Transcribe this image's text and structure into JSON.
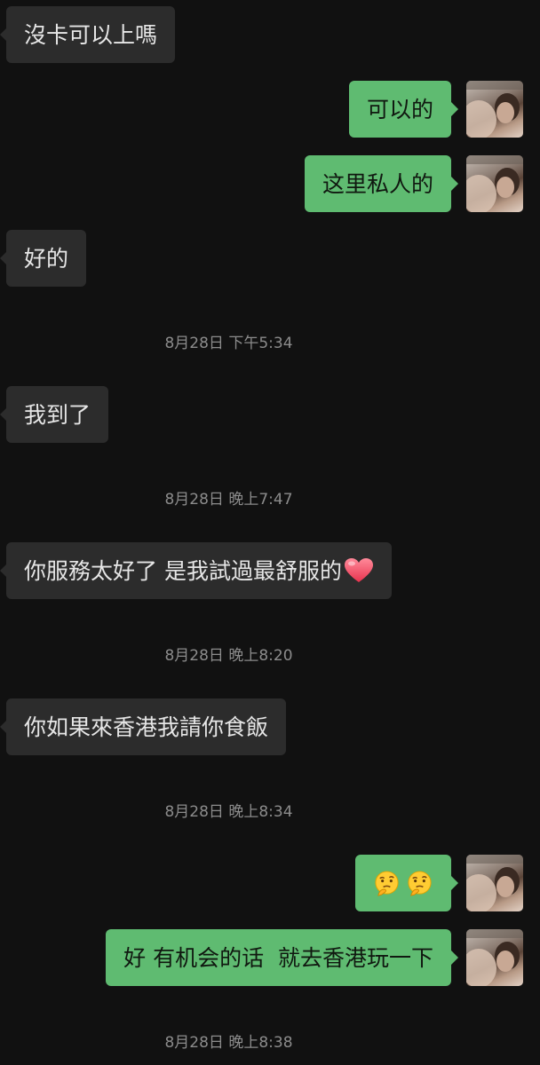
{
  "messages": [
    {
      "text": "沒卡可以上嗎"
    },
    {
      "text": "可以的"
    },
    {
      "text": "这里私人的"
    },
    {
      "text": "好的"
    },
    {
      "text": "我到了"
    },
    {
      "text": "你服務太好了 是我試過最舒服的"
    },
    {
      "text": "你如果來香港我請你食飯"
    },
    {
      "text": "好 有机会的话  就去香港玩一下"
    }
  ],
  "timestamps": [
    "8月28日 下午5:34",
    "8月28日 晚上7:47",
    "8月28日 晚上8:20",
    "8月28日 晚上8:34",
    "8月28日 晚上8:38"
  ],
  "emojis": {
    "heart": "red-heart-emoji",
    "thinking": "thinking-face-emoji"
  },
  "colors": {
    "background": "#111111",
    "incoming_bubble": "#2c2c2c",
    "outgoing_bubble": "#5fbb71",
    "timestamp_text": "#8c8c8c"
  }
}
